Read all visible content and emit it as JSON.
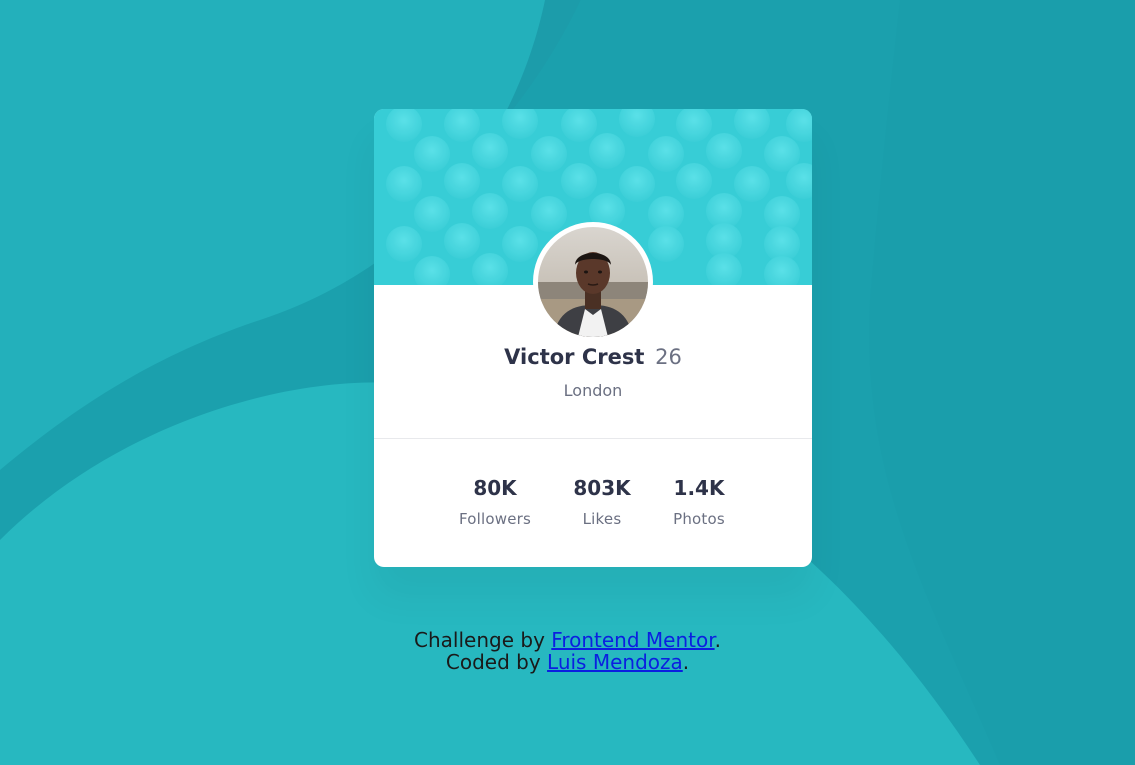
{
  "profile": {
    "name": "Victor Crest",
    "age": "26",
    "location": "London",
    "avatar_icon": "user-photo-icon"
  },
  "stats": [
    {
      "value": "80K",
      "label": "Followers"
    },
    {
      "value": "803K",
      "label": "Likes"
    },
    {
      "value": "1.4K",
      "label": "Photos"
    }
  ],
  "attribution": {
    "challenge_prefix": "Challenge by ",
    "challenge_link": "Frontend Mentor",
    "challenge_suffix": ".",
    "coded_prefix": "Coded by ",
    "coded_link": "Luis Mendoza",
    "coded_suffix": "."
  },
  "colors": {
    "background": "#1ca3b0",
    "header_pattern": "#3cd3db",
    "text_dark": "#2e3349",
    "text_muted": "#6b7082",
    "link": "#0b1fe0"
  }
}
